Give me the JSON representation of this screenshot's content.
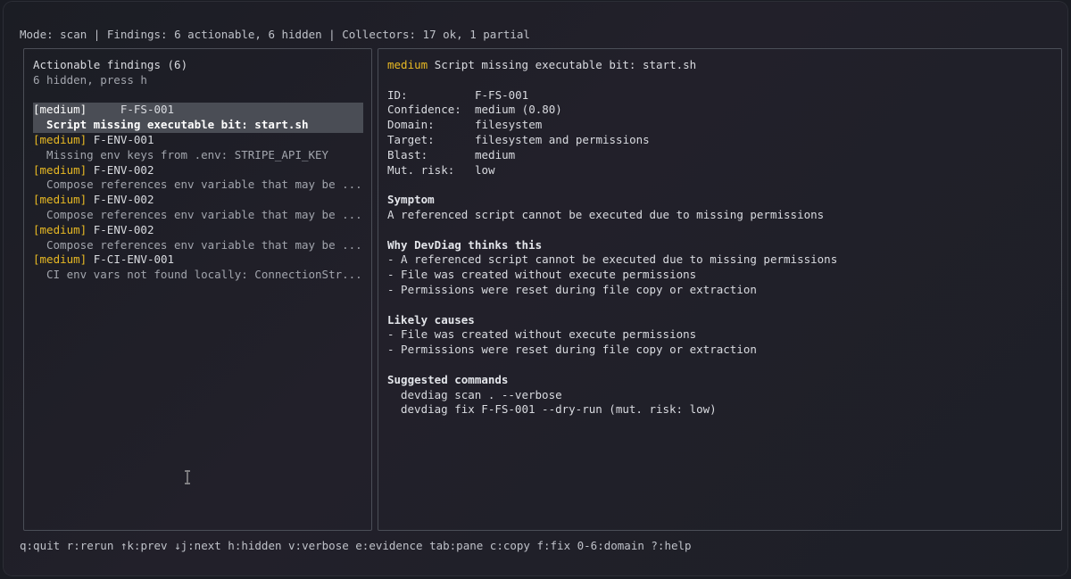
{
  "status": {
    "text": "Mode: scan | Findings: 6 actionable, 6 hidden | Collectors: 17 ok, 1 partial"
  },
  "findings_pane": {
    "title": "Actionable findings (6)",
    "hidden_hint": "6 hidden, press h",
    "items": [
      {
        "severity": "[medium]",
        "id": "F-FS-001",
        "summary": "Script missing executable bit: start.sh",
        "selected": true
      },
      {
        "severity": "[medium]",
        "id": "F-ENV-001",
        "summary": "Missing env keys from .env: STRIPE_API_KEY",
        "selected": false
      },
      {
        "severity": "[medium]",
        "id": "F-ENV-002",
        "summary": "Compose references env variable that may be ...",
        "selected": false
      },
      {
        "severity": "[medium]",
        "id": "F-ENV-002",
        "summary": "Compose references env variable that may be ...",
        "selected": false
      },
      {
        "severity": "[medium]",
        "id": "F-ENV-002",
        "summary": "Compose references env variable that may be ...",
        "selected": false
      },
      {
        "severity": "[medium]",
        "id": "F-CI-ENV-001",
        "summary": "CI env vars not found locally: ConnectionStr...",
        "selected": false
      }
    ]
  },
  "detail_pane": {
    "severity": "medium",
    "title": "Script missing executable bit: start.sh",
    "fields": [
      {
        "label": "ID:",
        "value": "F-FS-001"
      },
      {
        "label": "Confidence:",
        "value": "medium (0.80)"
      },
      {
        "label": "Domain:",
        "value": "filesystem"
      },
      {
        "label": "Target:",
        "value": "filesystem and permissions"
      },
      {
        "label": "Blast:",
        "value": "medium"
      },
      {
        "label": "Mut. risk:",
        "value": "low"
      }
    ],
    "symptom_heading": "Symptom",
    "symptom": "A referenced script cannot be executed due to missing permissions",
    "why_heading": "Why DevDiag thinks this",
    "why": [
      "- A referenced script cannot be executed due to missing permissions",
      "- File was created without execute permissions",
      "- Permissions were reset during file copy or extraction"
    ],
    "causes_heading": "Likely causes",
    "causes": [
      "- File was created without execute permissions",
      "- Permissions were reset during file copy or extraction"
    ],
    "commands_heading": "Suggested commands",
    "commands": [
      "devdiag scan . --verbose",
      "devdiag fix F-FS-001 --dry-run (mut. risk: low)"
    ]
  },
  "keybar": {
    "text": "q:quit r:rerun ↑k:prev ↓j:next h:hidden v:verbose e:evidence tab:pane c:copy f:fix 0-6:domain ?:help"
  },
  "icons": {
    "cursor": "text-cursor-icon"
  }
}
